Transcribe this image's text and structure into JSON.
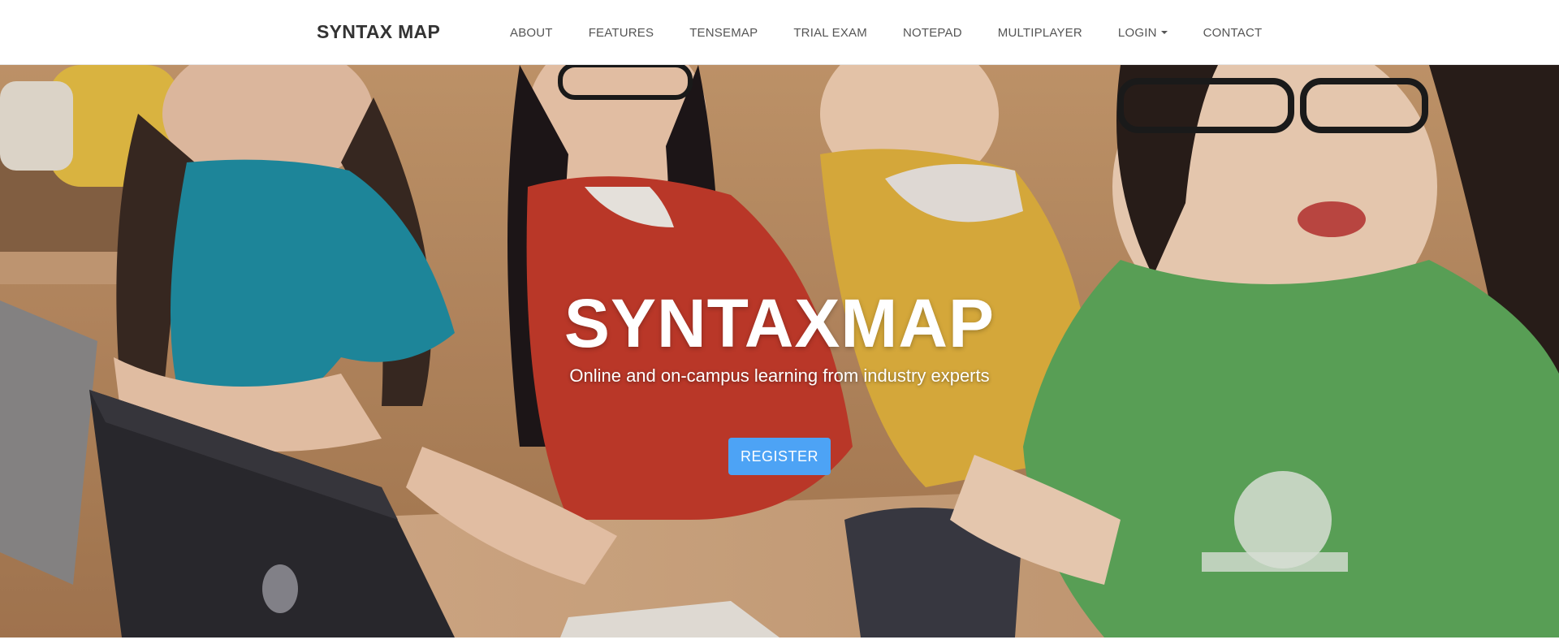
{
  "navbar": {
    "brand": "SYNTAX MAP",
    "items": [
      {
        "label": "ABOUT"
      },
      {
        "label": "FEATURES"
      },
      {
        "label": "TENSEMAP"
      },
      {
        "label": "TRIAL EXAM"
      },
      {
        "label": "NOTEPAD"
      },
      {
        "label": "MULTIPLAYER"
      },
      {
        "label": "LOGIN",
        "dropdown": true
      },
      {
        "label": "CONTACT"
      }
    ]
  },
  "hero": {
    "title": "SYNTAXMAP",
    "subtitle": "Online and on-campus learning from industry experts",
    "register_label": "REGISTER"
  },
  "colors": {
    "accent": "#4da3f5",
    "nav_text": "#555555",
    "brand_text": "#333333"
  },
  "icons": {
    "login_dropdown": "caret-down-icon"
  }
}
